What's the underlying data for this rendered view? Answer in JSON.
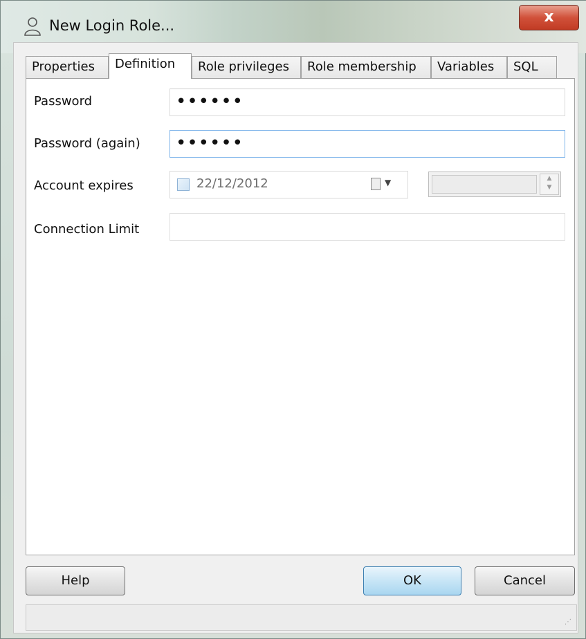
{
  "window": {
    "title": "New Login Role...",
    "close_label": "x"
  },
  "tabs": [
    {
      "label": "Properties"
    },
    {
      "label": "Definition"
    },
    {
      "label": "Role privileges"
    },
    {
      "label": "Role membership"
    },
    {
      "label": "Variables"
    },
    {
      "label": "SQL"
    }
  ],
  "active_tab": "Definition",
  "form": {
    "password": {
      "label": "Password",
      "value": "••••••"
    },
    "password_again": {
      "label": "Password (again)",
      "value": "••••••"
    },
    "account_expires": {
      "label": "Account expires",
      "checked": false,
      "date": "22/12/2012",
      "time": ""
    },
    "connection_limit": {
      "label": "Connection Limit",
      "value": ""
    }
  },
  "buttons": {
    "help": "Help",
    "ok": "OK",
    "cancel": "Cancel"
  },
  "spin": {
    "up": "▲",
    "down": "▼"
  },
  "icons": [
    "user-icon",
    "close-icon",
    "calendar-icon",
    "chevron-down-icon",
    "spin-up-icon",
    "spin-down-icon",
    "resize-grip-icon"
  ]
}
